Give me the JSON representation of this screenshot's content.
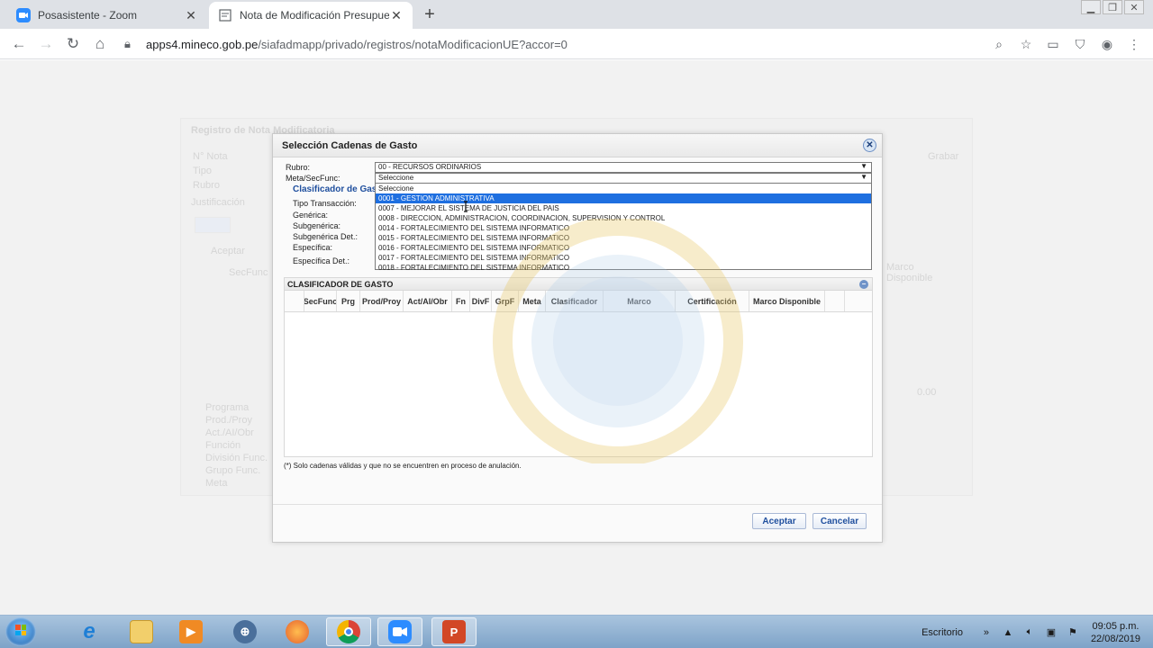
{
  "browser": {
    "tabs": [
      {
        "title": "Posasistente - Zoom",
        "active": false
      },
      {
        "title": "Nota de Modificación Presupuesta",
        "active": true
      }
    ],
    "url_host": "apps4.mineco.gob.pe",
    "url_path": "/siafadmapp/privado/registros/notaModificacionUE?accor=0"
  },
  "background": {
    "title": "Registro de Nota Modificatoria",
    "labels": [
      "N° Nota",
      "Tipo",
      "Rubro",
      "Justificación"
    ],
    "grabar": "Grabar",
    "aceptar": "Aceptar",
    "secfunc": "SecFunc",
    "marco": "Marco Disponible",
    "amount": "0.00",
    "bottom_labels": [
      "Programa",
      "Prod./Proy",
      "Act./AI/Obr",
      "Función",
      "División Func.",
      "Grupo Func.",
      "Meta"
    ]
  },
  "modal": {
    "title": "Selección Cadenas de Gasto",
    "rubro_label": "Rubro:",
    "rubro_value": "00 - RECURSOS ORDINARIOS",
    "meta_label": "Meta/SecFunc:",
    "meta_value": "Seleccione",
    "section_clasificador": "Clasificador de Gasto",
    "fields": [
      "Tipo Transacción:",
      "Genérica:",
      "Subgenérica:",
      "Subgenérica Det.:",
      "Específica:",
      "Específica Det.:"
    ],
    "dropdown_options": [
      {
        "label": "Seleccione",
        "selected": false
      },
      {
        "label": "0001 - GESTION ADMINISTRATIVA",
        "selected": true
      },
      {
        "label": "0007 - MEJORAR EL SISTEMA DE JUSTICIA DEL PAIS",
        "selected": false
      },
      {
        "label": "0008 - DIRECCION, ADMINISTRACION, COORDINACION, SUPERVISION Y CONTROL",
        "selected": false
      },
      {
        "label": "0014 - FORTALECIMIENTO DEL SISTEMA INFORMATICO",
        "selected": false
      },
      {
        "label": "0015 - FORTALECIMIENTO DEL SISTEMA INFORMATICO",
        "selected": false
      },
      {
        "label": "0016 - FORTALECIMIENTO DEL SISTEMA INFORMATICO",
        "selected": false
      },
      {
        "label": "0017 - FORTALECIMIENTO DEL SISTEMA INFORMATICO",
        "selected": false
      },
      {
        "label": "0018 - FORTALECIMIENTO DEL SISTEMA INFORMATICO",
        "selected": false
      }
    ],
    "grid_title": "CLASIFICADOR DE GASTO",
    "columns": [
      "SecFunc",
      "Prg",
      "Prod/Proy",
      "Act/AI/Obr",
      "Fn",
      "DivF",
      "GrpF",
      "Meta",
      "Clasificador",
      "Marco",
      "Certificación",
      "Marco Disponible"
    ],
    "note": "(*) Solo cadenas válidas y que no se encuentren en proceso de anulación.",
    "accept_label": "Aceptar",
    "cancel_label": "Cancelar"
  },
  "taskbar": {
    "desktop_label": "Escritorio",
    "time": "09:05 p.m.",
    "date": "22/08/2019"
  },
  "colors": {
    "accent": "#1f4f9e",
    "selection": "#1e6fe0",
    "taskbar": "#7ea3c8"
  }
}
